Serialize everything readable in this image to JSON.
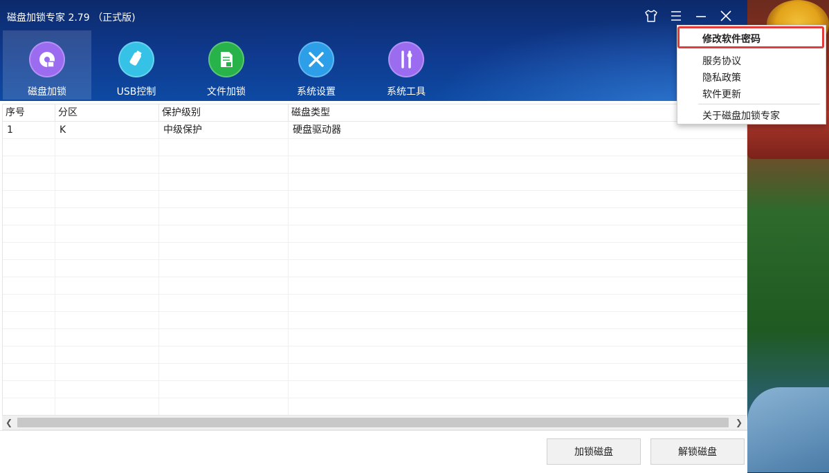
{
  "window": {
    "title": "磁盘加锁专家 2.79 （正式版)"
  },
  "toolbar": {
    "items": [
      {
        "label": "磁盘加锁",
        "icon": "disk-lock-icon",
        "color": "#9b6cf0",
        "active": true
      },
      {
        "label": "USB控制",
        "icon": "usb-drive-icon",
        "color": "#36c2e6",
        "active": false
      },
      {
        "label": "文件加锁",
        "icon": "file-lock-icon",
        "color": "#27b24a",
        "active": false
      },
      {
        "label": "系统设置",
        "icon": "tools-icon",
        "color": "#2d9ee8",
        "active": false
      },
      {
        "label": "系统工具",
        "icon": "toolkit-icon",
        "color": "#9b6cf0",
        "active": false
      }
    ]
  },
  "table": {
    "columns": [
      "序号",
      "分区",
      "保护级别",
      "磁盘类型"
    ],
    "rows": [
      [
        "1",
        "K",
        "中级保护",
        "硬盘驱动器"
      ]
    ]
  },
  "footer": {
    "lock_button": "加锁磁盘",
    "unlock_button": "解锁磁盘"
  },
  "menu": {
    "items": [
      "修改软件密码",
      "服务协议",
      "隐私政策",
      "软件更新",
      "关于磁盘加锁专家"
    ],
    "highlight_color": "#e23b3b"
  },
  "colors": {
    "header_top": "#0c2a6b",
    "header_bottom": "#0d4aa3"
  }
}
